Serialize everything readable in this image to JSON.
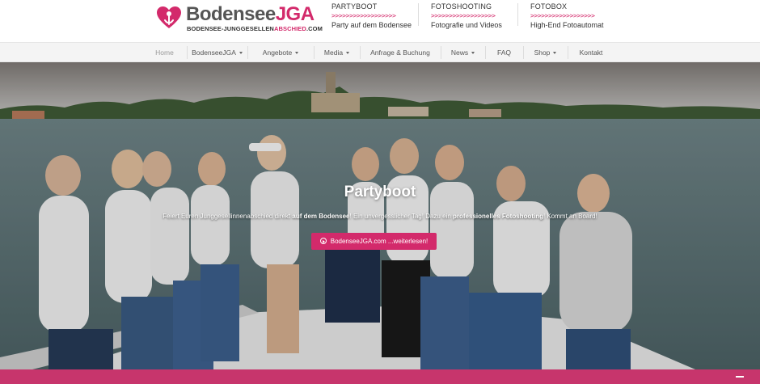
{
  "logo": {
    "text_part1": "Bodensee",
    "text_part2": "JGA",
    "subline_a": "BODENSEE-JUNGGESELLEN",
    "subline_b": "ABSCHIED",
    "subline_c": ".COM"
  },
  "promos": [
    {
      "title": "PARTYBOOT",
      "arrows": ">>>>>>>>>>>>>>>>>>",
      "subtitle": "Party auf dem Bodensee"
    },
    {
      "title": "FOTOSHOOTING",
      "arrows": ">>>>>>>>>>>>>>>>>>",
      "subtitle": "Fotografie und Videos"
    },
    {
      "title": "FOTOBOX",
      "arrows": ">>>>>>>>>>>>>>>>>>",
      "subtitle": "High-End Fotoautomat"
    }
  ],
  "nav": {
    "items": [
      {
        "label": "Home"
      },
      {
        "label": "BodenseeJGA"
      },
      {
        "label": "Angebote"
      },
      {
        "label": "Media"
      },
      {
        "label": "Anfrage & Buchung"
      },
      {
        "label": "News"
      },
      {
        "label": "FAQ"
      },
      {
        "label": "Shop"
      },
      {
        "label": "Kontakt"
      }
    ]
  },
  "hero": {
    "title": "Partyboot",
    "text_1": "Feiert Euren Junggesellinnenabschied direkt ",
    "text_bold_1": "auf dem Bodensee",
    "text_2": "! Ein unvergesslicher Tag! Dazu ein ",
    "text_bold_2": "professionelles Fotoshooting",
    "text_3": "! Kommt an Board!",
    "button_label": "BodenseeJGA.com ...weiterlesen!"
  },
  "colors": {
    "accent": "#d32a6b",
    "nav_bg": "#f4f4f4",
    "footer_bar": "#c7356c"
  },
  "icons": {
    "logo": "heart-logo-icon",
    "button": "play-circle-icon",
    "nav_dropdown": "caret-down-icon"
  }
}
